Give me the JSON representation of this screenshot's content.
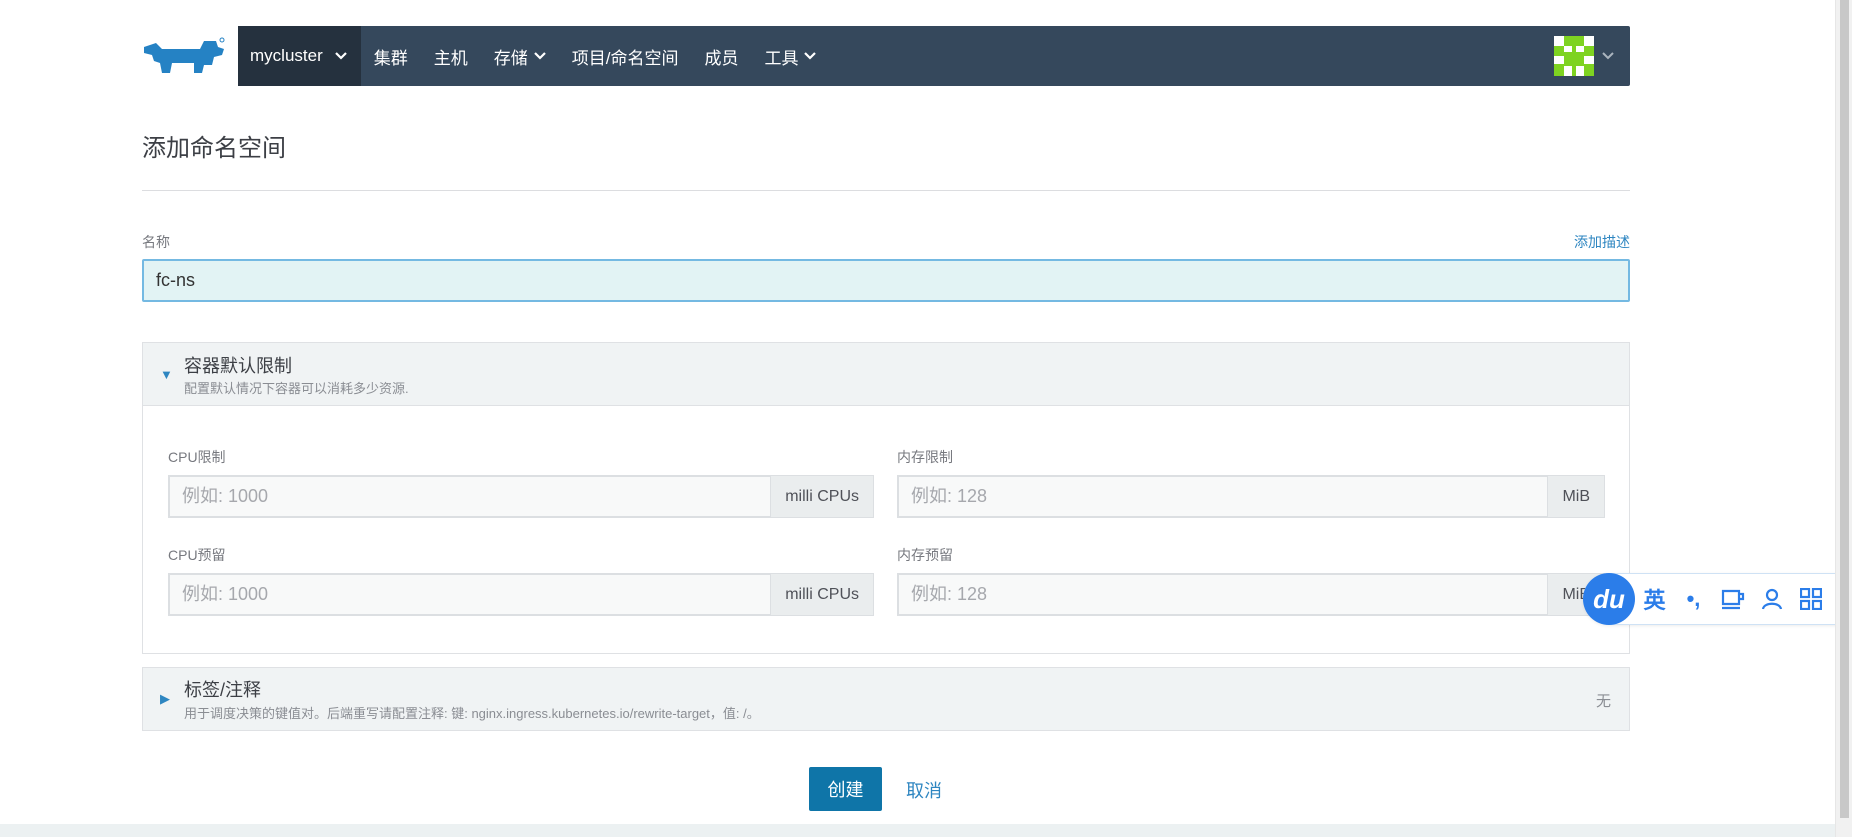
{
  "nav": {
    "cluster": "mycluster",
    "items": [
      {
        "label": "集群",
        "dropdown": false
      },
      {
        "label": "主机",
        "dropdown": false
      },
      {
        "label": "存储",
        "dropdown": true
      },
      {
        "label": "项目/命名空间",
        "dropdown": false
      },
      {
        "label": "成员",
        "dropdown": false
      },
      {
        "label": "工具",
        "dropdown": true
      }
    ]
  },
  "page": {
    "title": "添加命名空间"
  },
  "name": {
    "label": "名称",
    "value": "fc-ns",
    "add_description": "添加描述"
  },
  "container_limits": {
    "title": "容器默认限制",
    "subtitle": "配置默认情况下容器可以消耗多少资源.",
    "cpu_limit": {
      "label": "CPU限制",
      "placeholder": "例如: 1000",
      "unit": "milli CPUs"
    },
    "memory_limit": {
      "label": "内存限制",
      "placeholder": "例如: 128",
      "unit": "MiB"
    },
    "cpu_reservation": {
      "label": "CPU预留",
      "placeholder": "例如: 1000",
      "unit": "milli CPUs"
    },
    "memory_reservation": {
      "label": "内存预留",
      "placeholder": "例如: 128",
      "unit": "MiB"
    }
  },
  "labels_annotations": {
    "title": "标签/注释",
    "subtitle": "用于调度决策的键值对。后端重写请配置注释: 键: nginx.ingress.kubernetes.io/rewrite-target，值: /。",
    "status": "无"
  },
  "actions": {
    "create": "创建",
    "cancel": "取消"
  },
  "ime": {
    "logo": "du",
    "lang": "英",
    "punct": "•,",
    "items": [
      "cup-icon",
      "user-icon",
      "grid-icon"
    ]
  },
  "colors": {
    "nav_bg": "#35485c",
    "cluster_bg": "#25313e",
    "primary": "#0f75a8",
    "link": "#2e86c1",
    "ime": "#2b7de9"
  }
}
